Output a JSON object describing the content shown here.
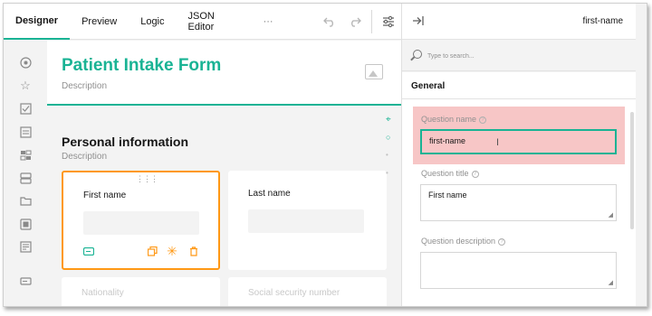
{
  "toolbar": {
    "tabs": [
      {
        "label": "Designer",
        "active": true
      },
      {
        "label": "Preview",
        "active": false
      },
      {
        "label": "Logic",
        "active": false
      },
      {
        "label": "JSON Editor",
        "active": false
      }
    ],
    "more_label": "···",
    "icons": [
      "undo-icon",
      "redo-icon",
      "settings-sliders-icon"
    ]
  },
  "icon_bar": [
    "radiogroup-icon",
    "rating-star-icon",
    "checkbox-icon",
    "dropdown-icon",
    "tagbox-icon",
    "ranking-icon",
    "panel-folder-icon",
    "image-picker-icon",
    "comment-icon",
    "text-input-icon"
  ],
  "survey": {
    "title": "Patient Intake Form",
    "description": "Description"
  },
  "page": {
    "title": "Personal information",
    "description": "Description"
  },
  "questions": [
    {
      "title": "First name",
      "selected": true
    },
    {
      "title": "Last name",
      "selected": false
    },
    {
      "title": "Nationality",
      "selected": false
    },
    {
      "title": "Social security number",
      "selected": false
    }
  ],
  "question_actions": [
    "input-type-icon",
    "duplicate-icon",
    "required-asterisk-icon",
    "delete-icon"
  ],
  "panel": {
    "selected_name": "first-name",
    "search_placeholder": "Type to search...",
    "section": "General",
    "properties": {
      "question_name_label": "Question name",
      "question_name_value": "first-name",
      "question_title_label": "Question title",
      "question_title_value": "First name",
      "question_description_label": "Question description",
      "question_description_value": ""
    }
  },
  "colors": {
    "accent": "#19b394",
    "selection": "#ff9814",
    "highlight": "#f7c6c6"
  }
}
